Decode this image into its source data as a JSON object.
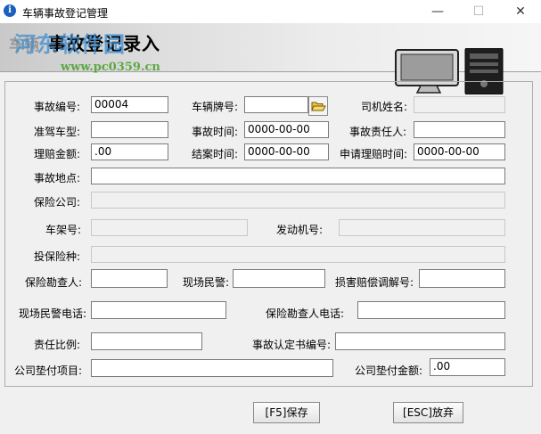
{
  "window": {
    "title": "车辆事故登记管理",
    "minimize": "—",
    "maximize": "☐",
    "close": "✕"
  },
  "banner": {
    "title": "事故登记录入",
    "subtitle": "车辆",
    "watermark": "河东软件园",
    "watermark_url": "www.pc0359.cn"
  },
  "form": {
    "accident_no": {
      "label": "事故编号:",
      "value": "00004"
    },
    "plate_no": {
      "label": "车辆牌号:",
      "value": ""
    },
    "driver_name": {
      "label": "司机姓名:",
      "value": ""
    },
    "license_type": {
      "label": "准驾车型:",
      "value": ""
    },
    "accident_time": {
      "label": "事故时间:",
      "value": "0000-00-00"
    },
    "responsible": {
      "label": "事故责任人:",
      "value": ""
    },
    "claim_amount": {
      "label": "理赔金额:",
      "value": ".00"
    },
    "close_time": {
      "label": "结案时间:",
      "value": "0000-00-00"
    },
    "claim_apply_time": {
      "label": "申请理赔时间:",
      "value": "0000-00-00"
    },
    "location": {
      "label": "事故地点:",
      "value": ""
    },
    "insurer": {
      "label": "保险公司:",
      "value": ""
    },
    "frame_no": {
      "label": "车架号:",
      "value": ""
    },
    "engine_no": {
      "label": "发动机号:",
      "value": ""
    },
    "insurance_type": {
      "label": "投保险种:",
      "value": ""
    },
    "surveyor": {
      "label": "保险勘查人:",
      "value": ""
    },
    "police": {
      "label": "现场民警:",
      "value": ""
    },
    "mediation_no": {
      "label": "损害赔偿调解号:",
      "value": ""
    },
    "police_phone": {
      "label": "现场民警电话:",
      "value": ""
    },
    "surveyor_phone": {
      "label": "保险勘查人电话:",
      "value": ""
    },
    "liability_ratio": {
      "label": "责任比例:",
      "value": ""
    },
    "certificate_no": {
      "label": "事故认定书编号:",
      "value": ""
    },
    "advance_item": {
      "label": "公司垫付项目:",
      "value": ""
    },
    "advance_amount": {
      "label": "公司垫付金额:",
      "value": ".00"
    }
  },
  "buttons": {
    "save": "[F5]保存",
    "cancel": "[ESC]放弃"
  },
  "icons": {
    "app": "info-icon",
    "browse": "folder-open-icon"
  }
}
